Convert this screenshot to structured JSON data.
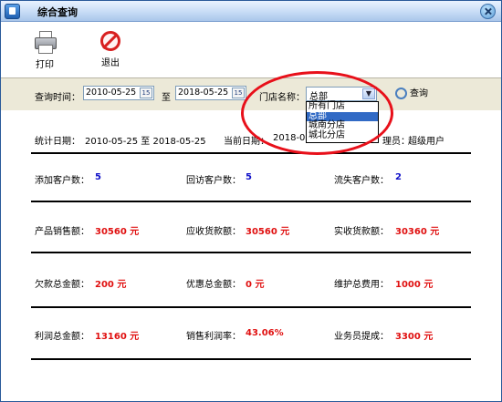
{
  "window": {
    "title": "综合查询"
  },
  "toolbar": {
    "print_label": "打印",
    "exit_label": "退出"
  },
  "filter": {
    "query_time_label": "查询时间：",
    "start_date": "2010-05-25",
    "to_label": "至",
    "end_date": "2018-05-25",
    "calendar_glyph": "15",
    "store_label": "门店名称：",
    "store_selected": "总部",
    "dropdown_glyph": "▼",
    "query_label": "查询"
  },
  "store_options": [
    "所有门店",
    "总部",
    "城南分店",
    "城北分店"
  ],
  "summary": {
    "stat_date_label": "统计日期：",
    "stat_date_range": "2010-05-25 至 2018-05-25",
    "current_date_label": "当前日期：",
    "current_date": "2018-05",
    "operator_label": "理员：",
    "operator_value": "超级用户"
  },
  "stats": {
    "row1": [
      {
        "label": "添加客户数：",
        "value": "5"
      },
      {
        "label": "回访客户数：",
        "value": "5"
      },
      {
        "label": "流失客户数：",
        "value": "2"
      }
    ],
    "row2": [
      {
        "label": "产品销售额：",
        "value": "30560 元"
      },
      {
        "label": "应收货款额：",
        "value": "30560 元"
      },
      {
        "label": "实收货款额：",
        "value": "30360 元"
      }
    ],
    "row3": [
      {
        "label": "欠款总金额：",
        "value": "200 元"
      },
      {
        "label": "优惠总金额：",
        "value": "0 元"
      },
      {
        "label": "维护总费用：",
        "value": "1000 元"
      }
    ],
    "row4": [
      {
        "label": "利润总金额：",
        "value": "13160 元"
      },
      {
        "label": "销售利润率：",
        "value": "43.06%"
      },
      {
        "label": "业务员提成：",
        "value": "3300 元"
      }
    ]
  },
  "colors": {
    "value_blue": "#1010c8",
    "value_red": "#e01010",
    "highlight": "#e8101a"
  }
}
